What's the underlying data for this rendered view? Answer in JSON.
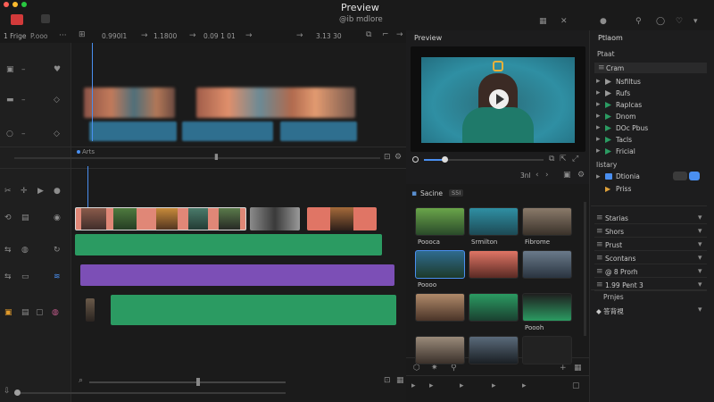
{
  "window": {
    "title": "Preview",
    "subtitle": "@ib mdlore"
  },
  "timeline_toolbar": {
    "left_label": "1 Frige",
    "left_sub": "P.ooo",
    "timecodes": [
      "0.990l1",
      "1.1800",
      "0.09 1 01",
      "3.13 30"
    ]
  },
  "timeline": {
    "divider_label": "Arts",
    "tracks": {
      "video_main": [
        "woman-green-bg",
        "man-green-shirt",
        "man-orange-jacket",
        "man-hood",
        "woman-teal",
        "man-beanie-bw",
        "man-cap-red"
      ]
    },
    "colors": {
      "audio": "#2b9b62",
      "purple": "#7c4fb6",
      "red": "#e07565",
      "blue": "#3b8dbd",
      "accent": "#4a8ff0"
    }
  },
  "preview": {
    "tab_label": "Preview",
    "playhead_text": "3nl",
    "colors": {
      "bg": "#2f8fa3"
    }
  },
  "media": {
    "header": "Sacine",
    "badge": "S5I",
    "items": [
      {
        "label": "Poooca",
        "kind": "woman-smile"
      },
      {
        "label": "Srmilton",
        "kind": "man-teal-bg"
      },
      {
        "label": "Fibrome",
        "kind": "man-blonde"
      },
      {
        "label": "Poooo",
        "kind": "man-green-shirt"
      },
      {
        "label": "",
        "kind": "man-cap-red"
      },
      {
        "label": "",
        "kind": "man-sneaker"
      },
      {
        "label": "",
        "kind": "man-smile"
      },
      {
        "label": "",
        "kind": "man-mask"
      },
      {
        "label": "Poooh",
        "kind": "green-jacket"
      },
      {
        "label": "",
        "kind": "man-face"
      },
      {
        "label": "",
        "kind": "man-dark"
      },
      {
        "label": "",
        "kind": ""
      }
    ]
  },
  "properties": {
    "tab_label": "Ptlaom",
    "sub_label": "Ptaat",
    "group_label": "Cram",
    "tree": [
      "Nsfiltus",
      "Rufs",
      "Raplcas",
      "Dnom",
      "DOc Pbus",
      "Tacls",
      "Fricial"
    ],
    "section_label": "Iistary",
    "tree2": [
      "Dtionia",
      "Priss"
    ],
    "bottom": [
      "Starias",
      "Shors",
      "Prust",
      "Scontans",
      "@ 8 Prorh",
      "1.99 Pent 3"
    ],
    "footer_label": "Prnjes",
    "footer_label2": "◆ 答背視"
  }
}
